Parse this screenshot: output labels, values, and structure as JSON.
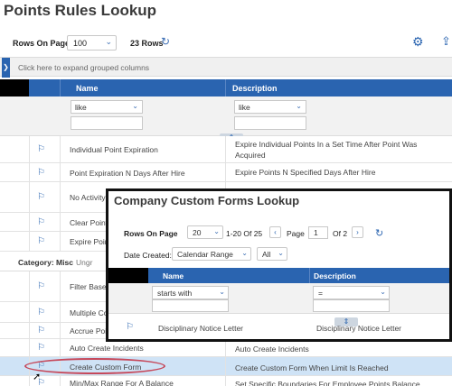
{
  "page": {
    "title": "Points Rules Lookup"
  },
  "toolbar": {
    "rows_label": "Rows On Page",
    "rows_value": "100",
    "row_count": "23 Rows",
    "refresh_icon": "refresh-icon",
    "settings_icon": "gear-icon",
    "export_icon": "export-icon"
  },
  "group_bar": {
    "text": "Click here to expand grouped columns"
  },
  "columns": {
    "name": "Name",
    "description": "Description"
  },
  "filters": {
    "name_op": "like",
    "desc_op": "like"
  },
  "rows_top": [
    {
      "name": "Individual Point Expiration",
      "description": "Expire Individual Points In a Set Time After Point Was Acquired"
    },
    {
      "name": "Point Expiration N Days After Hire",
      "description": "Expire Points N Specified Days After Hire"
    },
    {
      "name": "No Activity",
      "description": "Expire Points If No New Points Get Acquired Over Regular"
    },
    {
      "name": "Clear Point",
      "description": ""
    },
    {
      "name": "Expire Point",
      "description": ""
    }
  ],
  "category": {
    "label": "Category: Misc",
    "other": "Ungr"
  },
  "rows_bottom": [
    {
      "name": "Filter Base",
      "description": ""
    },
    {
      "name": "Multiple Co",
      "description": ""
    },
    {
      "name": "Accrue Poi",
      "description": ""
    },
    {
      "name": "Auto Create Incidents",
      "description": "Auto Create Incidents"
    },
    {
      "name": "Create Custom Form",
      "description": "Create Custom Form When Limit Is Reached"
    },
    {
      "name": "Min/Max Range For A Balance",
      "description": "Set Specific Boundaries For Employee Points Balance"
    }
  ],
  "overlay": {
    "title": "Company Custom Forms Lookup",
    "rows_label": "Rows On Page",
    "rows_value": "20",
    "range": "1-20 Of 25",
    "page_label": "Page",
    "page_value": "1",
    "page_of": "Of 2",
    "date_label": "Date Created:",
    "date_value": "Calendar Range",
    "all_value": "All",
    "columns": {
      "name": "Name",
      "description": "Description"
    },
    "filters": {
      "name_op": "starts with",
      "desc_op": "="
    },
    "row": {
      "name": "Disciplinary Notice Letter",
      "description": "Disciplinary Notice Letter"
    }
  },
  "colors": {
    "accent": "#2a64b0",
    "highlight": "#cfe3f6",
    "annotation": "#c6485a"
  }
}
